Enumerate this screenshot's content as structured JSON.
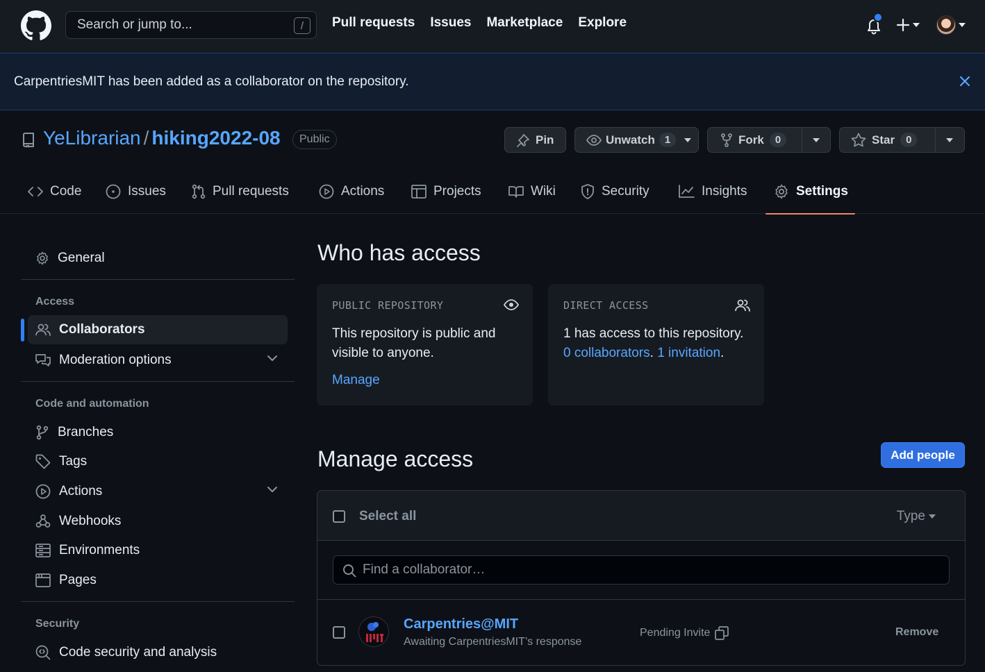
{
  "header": {
    "search_placeholder": "Search or jump to...",
    "search_shortcut": "/",
    "nav": [
      "Pull requests",
      "Issues",
      "Marketplace",
      "Explore"
    ],
    "notification_dot_color": "#2f81f7"
  },
  "flash": {
    "message": "CarpentriesMIT has been added as a collaborator on the repository."
  },
  "repo": {
    "owner": "YeLibrarian",
    "separator": "/",
    "name": "hiking2022-08",
    "visibility": "Public",
    "pin_label": "Pin",
    "unwatch_label": "Unwatch",
    "watch_count": "1",
    "fork_label": "Fork",
    "fork_count": "0",
    "star_label": "Star",
    "star_count": "0"
  },
  "tabs": [
    {
      "label": "Code",
      "icon": "code-icon"
    },
    {
      "label": "Issues",
      "icon": "issue-icon"
    },
    {
      "label": "Pull requests",
      "icon": "pull-request-icon"
    },
    {
      "label": "Actions",
      "icon": "play-icon"
    },
    {
      "label": "Projects",
      "icon": "table-icon"
    },
    {
      "label": "Wiki",
      "icon": "book-icon"
    },
    {
      "label": "Security",
      "icon": "shield-icon"
    },
    {
      "label": "Insights",
      "icon": "graph-icon"
    },
    {
      "label": "Settings",
      "icon": "gear-icon",
      "selected": true
    }
  ],
  "sidebar": {
    "general": "General",
    "access_heading": "Access",
    "collaborators": "Collaborators",
    "moderation": "Moderation options",
    "automation_heading": "Code and automation",
    "branches": "Branches",
    "tags": "Tags",
    "actions": "Actions",
    "webhooks": "Webhooks",
    "environments": "Environments",
    "pages": "Pages",
    "security_heading": "Security",
    "code_security": "Code security and analysis"
  },
  "who_has_access": {
    "title": "Who has access",
    "public_card": {
      "title": "PUBLIC REPOSITORY",
      "text": "This repository is public and visible to anyone.",
      "link": "Manage"
    },
    "direct_card": {
      "title": "DIRECT ACCESS",
      "text_a": "1 has access to this repository.",
      "link_collaborators": "0 collaborators",
      "sep": ".",
      "link_invitation": "1 invitation",
      "end": "."
    }
  },
  "manage_access": {
    "title": "Manage access",
    "add_people": "Add people",
    "select_all": "Select all",
    "type_filter": "Type",
    "find_placeholder": "Find a collaborator…",
    "rows": [
      {
        "name": "Carpentries@MIT",
        "subtitle": "Awaiting CarpentriesMIT’s response",
        "status": "Pending Invite",
        "action": "Remove"
      }
    ]
  },
  "colors": {
    "accent": "#58a6ff",
    "primary_button": "#2f6fe0",
    "selected_tab_underline": "#f78166"
  }
}
